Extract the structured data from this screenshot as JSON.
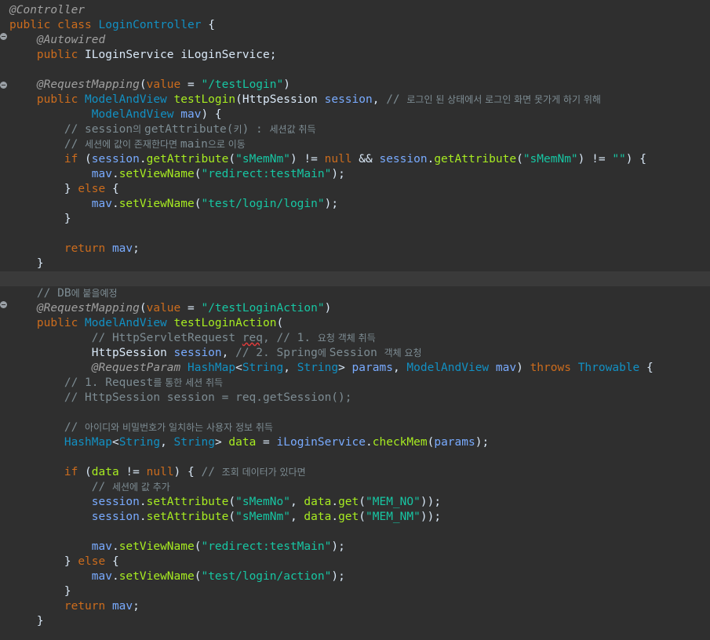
{
  "editor": {
    "language": "java",
    "class_annotation": "@Controller",
    "class_decl": "public class LoginController {",
    "field_annotation": "@Autowired",
    "field_decl": "public ILoginService iLoginService;",
    "method1": {
      "mapping": "@RequestMapping(value = \"/testLogin\")",
      "signature": "public ModelAndView testLogin(HttpSession session,",
      "signature_comment": "// 로그인 된 상태에서 로그인 화면 못가게 하기 위해",
      "param2": "ModelAndView mav) {",
      "comment1": "// session의 getAttribute(키) : 세션값 취득",
      "comment2": "// 세션에 값이 존재한다면 main으로 이동",
      "if_line": "if (session.getAttribute(\"sMemNm\") != null && session.getAttribute(\"sMemNm\") != \"\") {",
      "set_main": "mav.setViewName(\"redirect:testMain\");",
      "else": "} else {",
      "set_login": "mav.setViewName(\"test/login/login\");",
      "close_brace": "}",
      "return": "return mav;",
      "end": "}"
    },
    "method2": {
      "comment_db": "// DB에 붙을예정",
      "mapping": "@RequestMapping(value = \"/testLoginAction\")",
      "signature": "public ModelAndView testLoginAction(",
      "param_comment1": "// HttpServletRequest req, // 1. 요청 객체 취득",
      "param_session": "HttpSession session,",
      "param_comment2": "// 2. Spring에 Session 객체 요청",
      "param_last": "@RequestParam HashMap<String, String> params, ModelAndView mav) throws Throwable {",
      "comment3": "// 1. Request를 통한 세션 취득",
      "comment4": "// HttpSession session = req.getSession();",
      "comment5": "// 아이디와 비밀번호가 일치하는 사용자 정보 취득",
      "data_line": "HashMap<String, String> data = iLoginService.checkMem(params);",
      "if_line": "if (data != null) {",
      "if_comment": "// 조회 데이터가 있다면",
      "comment6": "// 세션에 값 추가",
      "set_no": "session.setAttribute(\"sMemNo\", data.get(\"MEM_NO\"));",
      "set_nm": "session.setAttribute(\"sMemNm\", data.get(\"MEM_NM\"));",
      "set_main": "mav.setViewName(\"redirect:testMain\");",
      "else": "} else {",
      "set_action": "mav.setViewName(\"test/login/action\");",
      "close_brace": "}",
      "return": "return mav;",
      "end": "}"
    }
  }
}
